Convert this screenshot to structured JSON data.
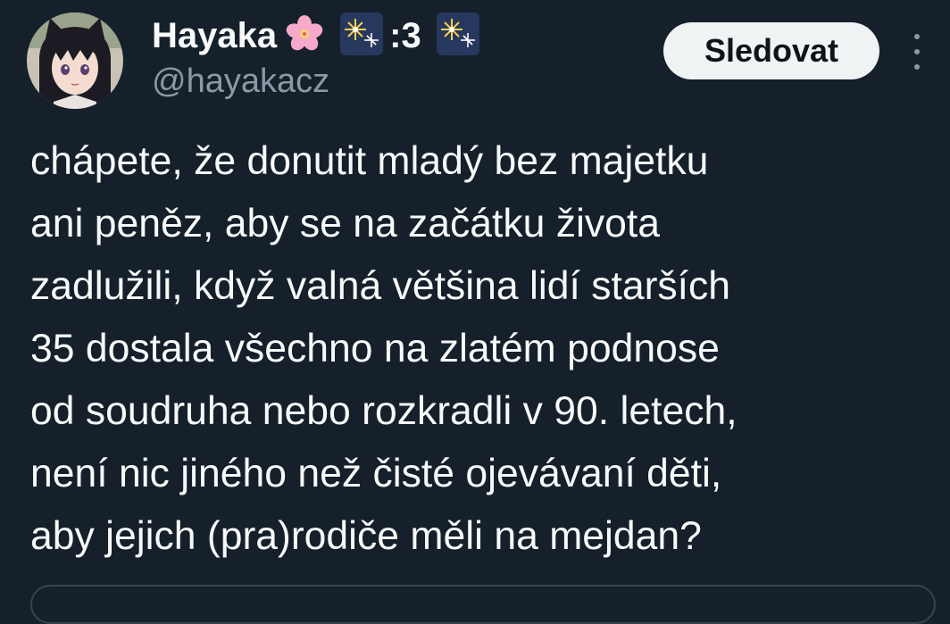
{
  "author": {
    "display_name": "Hayaka",
    "name_suffix": ":3",
    "name_emojis": [
      "cherry-blossom-icon",
      "fireworks-icon",
      "fireworks-icon"
    ],
    "handle": "@hayakacz",
    "avatar": "avatar-image"
  },
  "actions": {
    "follow_label": "Sledovat",
    "more_icon": "more-vertical-icon"
  },
  "tweet": {
    "lines": [
      "chápete, že donutit mladý bez majetku",
      "ani peněz, aby se na začátku života",
      "zadlužili, když valná většina lidí starších",
      "35 dostala všechno na zlatém podnose",
      "od soudruha nebo rozkradli v 90. letech,",
      "není nic jiného než čisté ojevávaní děti,",
      "aby jejich (pra)rodiče měli na mejdan?"
    ]
  },
  "colors": {
    "background": "#15202b",
    "text_primary": "#f7f9f9",
    "text_secondary": "#8b98a5",
    "button_bg": "#eff3f4",
    "button_text": "#0f1419",
    "border": "#38444d"
  }
}
